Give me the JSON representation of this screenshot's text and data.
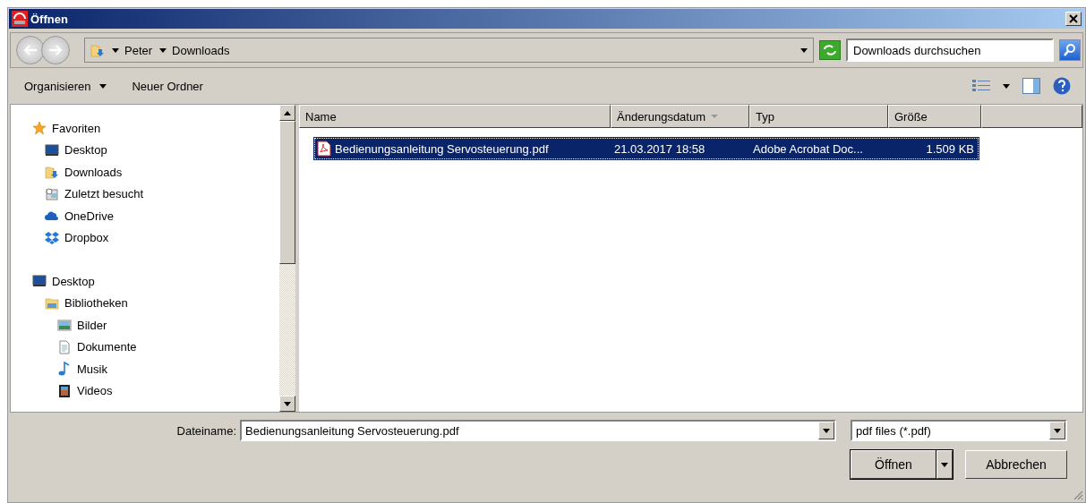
{
  "window": {
    "title": "Öffnen"
  },
  "address_bar": {
    "path": [
      "Peter",
      "Downloads"
    ],
    "search_placeholder": "Downloads durchsuchen"
  },
  "toolbar": {
    "items": [
      {
        "label": "Organisieren",
        "has_menu": true
      },
      {
        "label": "Neuer Ordner",
        "has_menu": false
      }
    ]
  },
  "sidebar": {
    "items": [
      {
        "label": "Favoriten",
        "kind": "star",
        "children": [
          {
            "label": "Desktop",
            "kind": "desktop"
          },
          {
            "label": "Downloads",
            "kind": "downloads"
          },
          {
            "label": "Zuletzt besucht",
            "kind": "recent"
          },
          {
            "label": "OneDrive",
            "kind": "onedrive"
          },
          {
            "label": "Dropbox",
            "kind": "dropbox"
          }
        ]
      },
      {
        "label": "Desktop",
        "kind": "desktop",
        "children": [
          {
            "label": "Bibliotheken",
            "kind": "library",
            "children": [
              {
                "label": "Bilder",
                "kind": "pictures"
              },
              {
                "label": "Dokumente",
                "kind": "documents"
              },
              {
                "label": "Musik",
                "kind": "music"
              },
              {
                "label": "Videos",
                "kind": "videos"
              }
            ]
          }
        ]
      }
    ]
  },
  "table": {
    "columns": [
      {
        "label": "Name",
        "sorted": false
      },
      {
        "label": "Änderungsdatum",
        "sorted": true
      },
      {
        "label": "Typ",
        "sorted": false
      },
      {
        "label": "Größe",
        "sorted": false
      }
    ],
    "rows": [
      {
        "name": "Bedienungsanleitung Servosteuerung.pdf",
        "date": "21.03.2017 18:58",
        "type": "Adobe Acrobat Doc...",
        "size": "1.509 KB",
        "selected": true
      }
    ]
  },
  "footer": {
    "filename_label": "Dateiname:",
    "filename": "Bedienungsanleitung Servosteuerung.pdf",
    "filter": "pdf files (*.pdf)",
    "buttons": [
      "Öffnen",
      "Abbrechen"
    ]
  }
}
